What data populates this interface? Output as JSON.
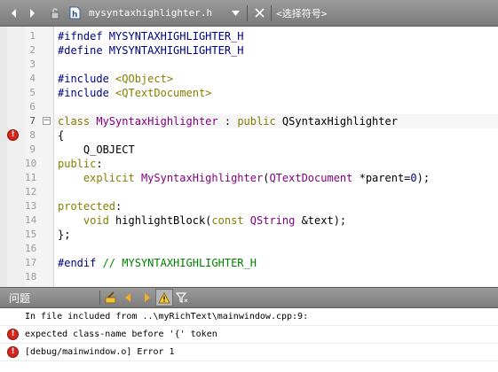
{
  "toolbar": {
    "file_name": "mysyntaxhighlighter.h",
    "symbols_label": "<选择符号>"
  },
  "editor": {
    "current_line": 7,
    "error_line": 8,
    "line_numbers": [
      "1",
      "2",
      "3",
      "4",
      "5",
      "6",
      "7",
      "8",
      "9",
      "10",
      "11",
      "12",
      "13",
      "14",
      "15",
      "16",
      "17",
      "18"
    ],
    "lines": [
      [
        {
          "t": "#ifndef MYSYNTAXHIGHLIGHTER_H",
          "c": "pre"
        }
      ],
      [
        {
          "t": "#define MYSYNTAXHIGHLIGHTER_H",
          "c": "pre"
        }
      ],
      [],
      [
        {
          "t": "#include ",
          "c": "pre"
        },
        {
          "t": "<QObject>",
          "c": "kw"
        }
      ],
      [
        {
          "t": "#include ",
          "c": "pre"
        },
        {
          "t": "<QTextDocument>",
          "c": "kw"
        }
      ],
      [],
      [
        {
          "t": "class ",
          "c": "kw"
        },
        {
          "t": "MySyntaxHighlighter",
          "c": "type"
        },
        {
          "t": " : ",
          "c": "plain"
        },
        {
          "t": "public ",
          "c": "kw"
        },
        {
          "t": "QSyntaxHighlighter",
          "c": "plain"
        }
      ],
      [
        {
          "t": "{",
          "c": "plain"
        }
      ],
      [
        {
          "t": "    Q_OBJECT",
          "c": "plain"
        }
      ],
      [
        {
          "t": "public",
          "c": "kw"
        },
        {
          "t": ":",
          "c": "plain"
        }
      ],
      [
        {
          "t": "    ",
          "c": "plain"
        },
        {
          "t": "explicit ",
          "c": "kw"
        },
        {
          "t": "MySyntaxHighlighter",
          "c": "type"
        },
        {
          "t": "(",
          "c": "plain"
        },
        {
          "t": "QTextDocument",
          "c": "type"
        },
        {
          "t": " *parent=",
          "c": "plain"
        },
        {
          "t": "0",
          "c": "num"
        },
        {
          "t": ");",
          "c": "plain"
        }
      ],
      [],
      [
        {
          "t": "protected",
          "c": "kw"
        },
        {
          "t": ":",
          "c": "plain"
        }
      ],
      [
        {
          "t": "    ",
          "c": "plain"
        },
        {
          "t": "void ",
          "c": "kw"
        },
        {
          "t": "highlightBlock(",
          "c": "plain"
        },
        {
          "t": "const ",
          "c": "kw"
        },
        {
          "t": "QString",
          "c": "type"
        },
        {
          "t": " &text);",
          "c": "plain"
        }
      ],
      [
        {
          "t": "};",
          "c": "plain"
        }
      ],
      [],
      [
        {
          "t": "#endif ",
          "c": "pre"
        },
        {
          "t": "// MYSYNTAXHIGHLIGHTER_H",
          "c": "cmt"
        }
      ],
      []
    ]
  },
  "issues_panel": {
    "title": "问题",
    "items": [
      {
        "type": "info",
        "text": "In file included from ..\\myRichText\\mainwindow.cpp:9:"
      },
      {
        "type": "error",
        "text": "expected class-name before '{' token"
      },
      {
        "type": "error",
        "text": "[debug/mainwindow.o] Error 1"
      }
    ]
  },
  "colors": {
    "preprocessor": "#000080",
    "keyword": "#808000",
    "type": "#800080",
    "comment": "#008000",
    "error": "#d6261c"
  }
}
